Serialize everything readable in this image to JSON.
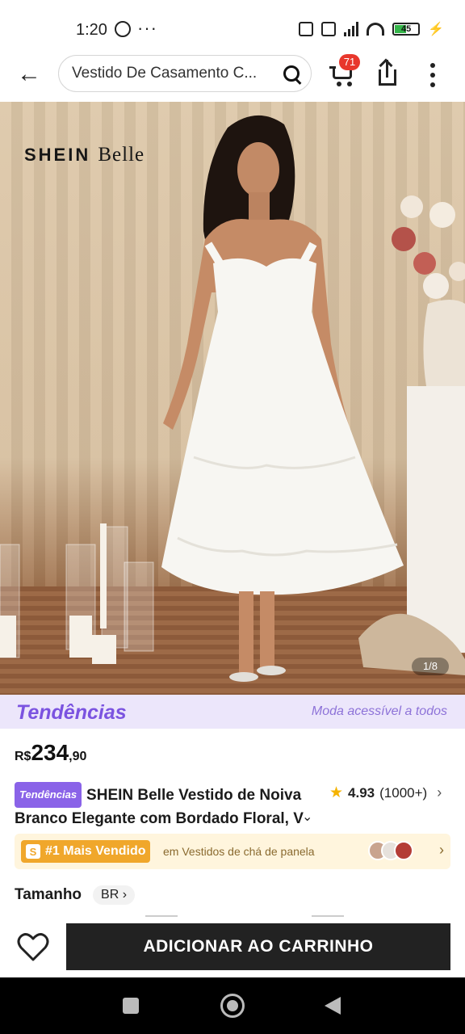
{
  "status_bar": {
    "time": "1:20",
    "more": "···",
    "battery": "45"
  },
  "header": {
    "search_text": "Vestido De Casamento C...",
    "cart_badge": "71"
  },
  "hero": {
    "brand_main": "SHEIN",
    "brand_sub": "Belle",
    "image_counter": "1/8"
  },
  "banner": {
    "logo": "Tendências",
    "tagline": "Moda acessível a todos"
  },
  "price": {
    "currency": "R$",
    "integer": "234",
    "decimal": ",90"
  },
  "product": {
    "tag": "Tendências",
    "title_line1": "SHEIN Belle Vestido de Noiva",
    "title_line2": "Branco Elegante com Bordado Floral, V",
    "rating_score": "4.93",
    "rating_count": "(1000+)"
  },
  "best_seller": {
    "icon_letter": "S",
    "label": "#1 Mais Vendido",
    "category": "em Vestidos de chá de panela"
  },
  "size": {
    "label": "Tamanho",
    "region": "BR"
  },
  "actions": {
    "add_to_cart": "ADICIONAR AO CARRINHO"
  },
  "colors": {
    "accent_purple": "#7b53e0",
    "badge_red": "#e8372c",
    "best_orange": "#f0a72b",
    "star": "#f5b300",
    "cta_bg": "#222222"
  }
}
